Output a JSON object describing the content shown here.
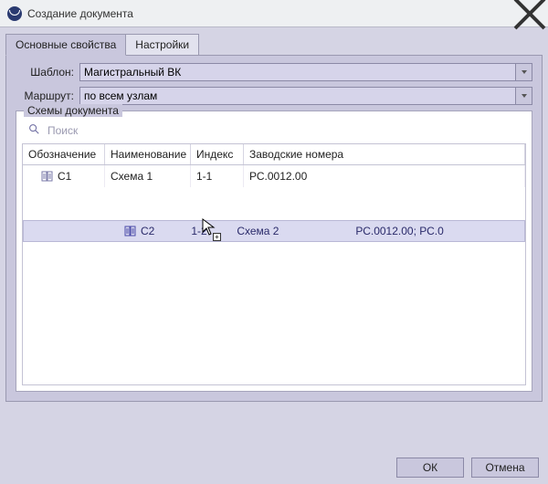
{
  "window": {
    "title": "Создание документа"
  },
  "tabs": [
    {
      "label": "Основные свойства",
      "active": true
    },
    {
      "label": "Настройки",
      "active": false
    }
  ],
  "form": {
    "template_label": "Шаблон:",
    "template_value": "Магистральный ВК",
    "route_label": "Маршрут:",
    "route_value": "по всем узлам"
  },
  "group": {
    "legend": "Схемы документа",
    "search_placeholder": "Поиск"
  },
  "table": {
    "columns": {
      "designation": "Обозначение",
      "name": "Наименование",
      "index": "Индекс",
      "factory": "Заводские номера"
    },
    "rows": [
      {
        "designation": "С1",
        "name": "Схема 1",
        "index": "1-1",
        "factory": "РС.0012.00"
      }
    ],
    "drag_row": {
      "designation": "С2",
      "index": "1-2",
      "name": "Схема 2",
      "factory": "РС.0012.00; РС.0"
    }
  },
  "footer": {
    "ok": "ОК",
    "cancel": "Отмена"
  }
}
